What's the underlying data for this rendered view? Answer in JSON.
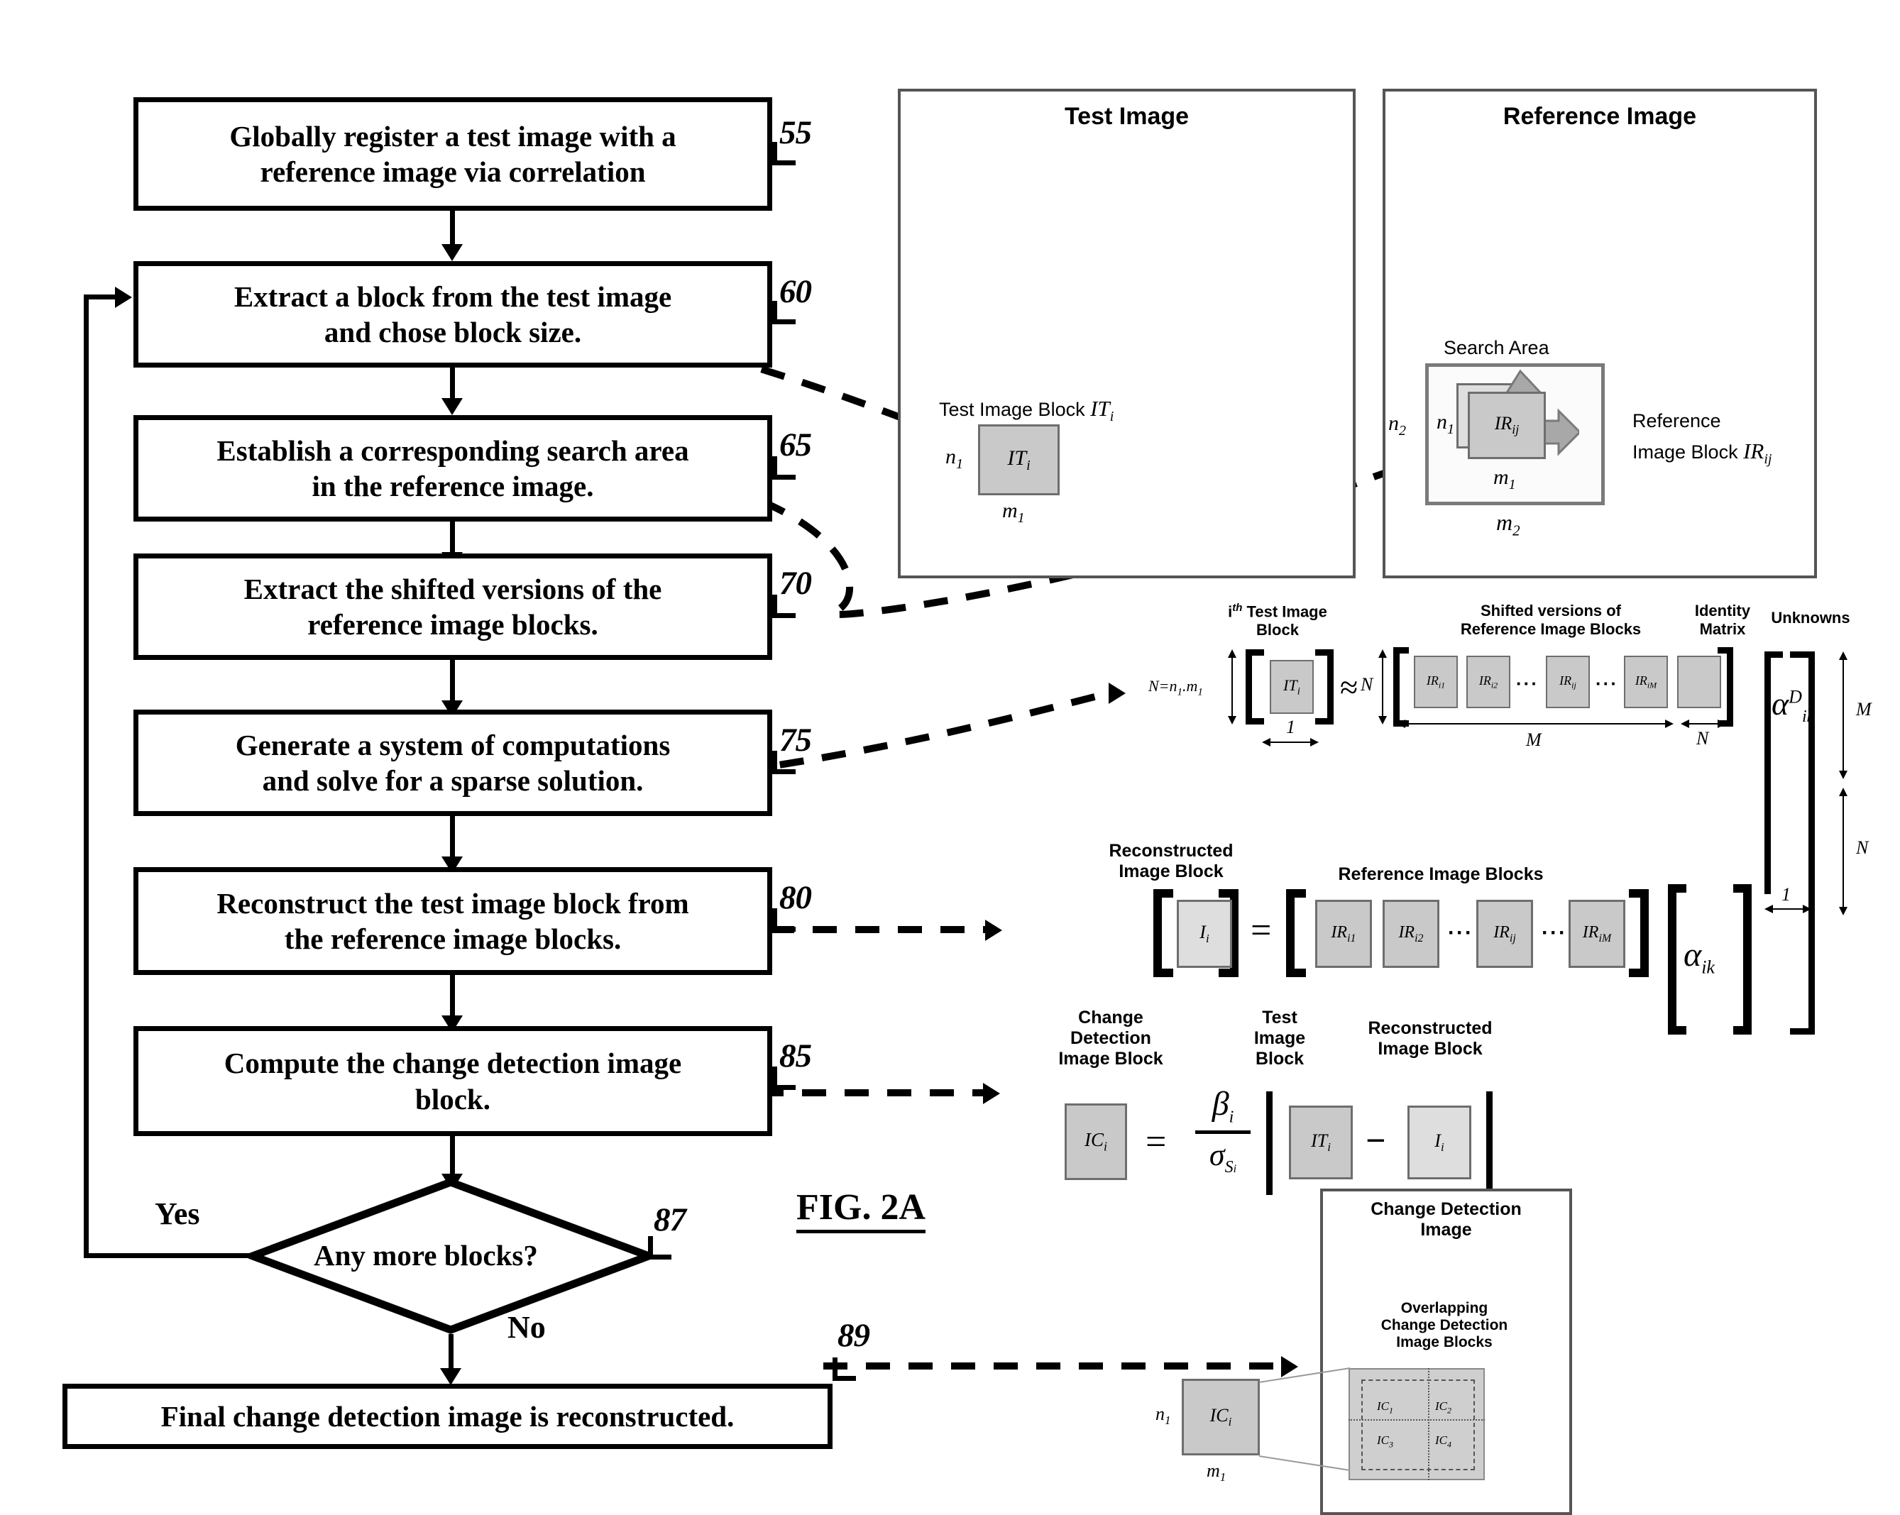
{
  "figure": {
    "label": "FIG. 2A"
  },
  "flow": {
    "steps": [
      {
        "id": "s55",
        "text_lines": [
          "Globally register a test image with a",
          "reference image via correlation"
        ],
        "ref": "55"
      },
      {
        "id": "s60",
        "text_lines": [
          "Extract a block from the test image",
          "and chose block size."
        ],
        "ref": "60"
      },
      {
        "id": "s65",
        "text_lines": [
          "Establish a corresponding search area",
          "in the reference image."
        ],
        "ref": "65"
      },
      {
        "id": "s70",
        "text_lines": [
          "Extract the shifted versions of the",
          "reference image blocks."
        ],
        "ref": "70"
      },
      {
        "id": "s75",
        "text_lines": [
          "Generate a system of computations",
          "and solve for a sparse solution."
        ],
        "ref": "75"
      },
      {
        "id": "s80",
        "text_lines": [
          "Reconstruct the test image block from",
          "the reference image blocks."
        ],
        "ref": "80"
      },
      {
        "id": "s85",
        "text_lines": [
          "Compute the change detection image",
          "block."
        ],
        "ref": "85"
      }
    ],
    "decision": {
      "text": "Any more blocks?",
      "ref": "87",
      "yes_label": "Yes",
      "no_label": "No"
    },
    "final": {
      "text": "Final change detection image is reconstructed.",
      "ref": "89"
    }
  },
  "test_image_panel": {
    "title": "Test Image",
    "block_caption": "Test Image Block",
    "block_caption_symbol": "IT",
    "block_caption_sub": "i",
    "block_label": "IT",
    "block_label_sub": "i",
    "height_label": "n",
    "height_sub": "1",
    "width_label": "m",
    "width_sub": "1"
  },
  "reference_image_panel": {
    "title": "Reference Image",
    "search_area_label": "Search Area",
    "block_caption_line1": "Reference",
    "block_caption_line2": "Image Block",
    "block_caption_symbol": "IR",
    "block_caption_sub": "ij",
    "block_label": "IR",
    "block_label_sub": "ij",
    "outer_height_label": "n",
    "outer_height_sub": "2",
    "outer_width_label": "m",
    "outer_width_sub": "2",
    "inner_height_label": "n",
    "inner_height_sub": "1",
    "inner_width_label": "m",
    "inner_width_sub": "1"
  },
  "system_equation": {
    "test_block_caption_line1": "i",
    "test_block_caption_sup": "th",
    "test_block_caption_line1b": " Test Image",
    "test_block_caption_line2": "Block",
    "shifted_caption_line1": "Shifted versions of",
    "shifted_caption_line2": "Reference Image Blocks",
    "identity_caption_line1": "Identity",
    "identity_caption_line2": "Matrix",
    "unknowns_caption": "Unknowns",
    "n_equals": "N=n",
    "n_equals_sub1": "1",
    "n_equals_mid": ".m",
    "n_equals_sub2": "1",
    "lhs_block": "IT",
    "lhs_block_sub": "i",
    "approx_symbol": "≈",
    "row_dim_left": "N",
    "col_dim_left": "1",
    "row_dim_right": "N",
    "blocks": [
      {
        "label": "IR",
        "sub": "i1"
      },
      {
        "label": "IR",
        "sub": "i2"
      },
      {
        "label": "IR",
        "sub": "ij"
      },
      {
        "label": "IR",
        "sub": "iM"
      }
    ],
    "ellipsis": "···",
    "span_M": "M",
    "span_N": "N",
    "unknown_symbol": "α",
    "unknown_sup": "D",
    "unknown_sub": "ik",
    "unknown_dim_M": "M",
    "unknown_dim_N": "N",
    "unknown_width": "1"
  },
  "reconstruction_equation": {
    "lhs_caption_line1": "Reconstructed",
    "lhs_caption_line2": "Image Block",
    "rhs_caption": "Reference Image Blocks",
    "lhs_block": "I",
    "lhs_block_sub": "i",
    "equals_symbol": "=",
    "blocks": [
      {
        "label": "IR",
        "sub": "i1"
      },
      {
        "label": "IR",
        "sub": "i2"
      },
      {
        "label": "IR",
        "sub": "ij"
      },
      {
        "label": "IR",
        "sub": "iM"
      }
    ],
    "ellipsis": "···",
    "coeff_symbol": "α",
    "coeff_sub": "ik"
  },
  "change_detection_equation": {
    "lhs_caption_line1": "Change",
    "lhs_caption_line2": "Detection",
    "lhs_caption_line3": "Image Block",
    "test_caption_line1": "Test",
    "test_caption_line2": "Image",
    "test_caption_line3": "Block",
    "recon_caption_line1": "Reconstructed",
    "recon_caption_line2": "Image Block",
    "lhs_block": "IC",
    "lhs_block_sub": "i",
    "equals_symbol": "=",
    "numerator": "β",
    "numerator_sub": "i",
    "denominator": "σ",
    "denominator_sub": "S",
    "denominator_sub2": "i",
    "test_block": "IT",
    "test_block_sub": "i",
    "minus_symbol": "−",
    "recon_block": "I",
    "recon_block_sub": "i"
  },
  "change_detection_panel": {
    "title_line1": "Change Detection",
    "title_line2": "Image",
    "overlap_caption_line1": "Overlapping",
    "overlap_caption_line2": "Change Detection",
    "overlap_caption_line3": "Image Blocks",
    "source_block_label": "IC",
    "source_block_sub": "i",
    "source_height_label": "n",
    "source_height_sub": "1",
    "source_width_label": "m",
    "source_width_sub": "1",
    "inner_blocks": [
      {
        "label": "IC",
        "sub": "1"
      },
      {
        "label": "IC",
        "sub": "2"
      },
      {
        "label": "IC",
        "sub": "3"
      },
      {
        "label": "IC",
        "sub": "4"
      }
    ]
  },
  "colors": {
    "line": "#000000",
    "panel_border": "#555555",
    "block_fill": "#c9c9c9",
    "block_fill_light": "#dedede",
    "block_border": "#6e6e6e"
  }
}
